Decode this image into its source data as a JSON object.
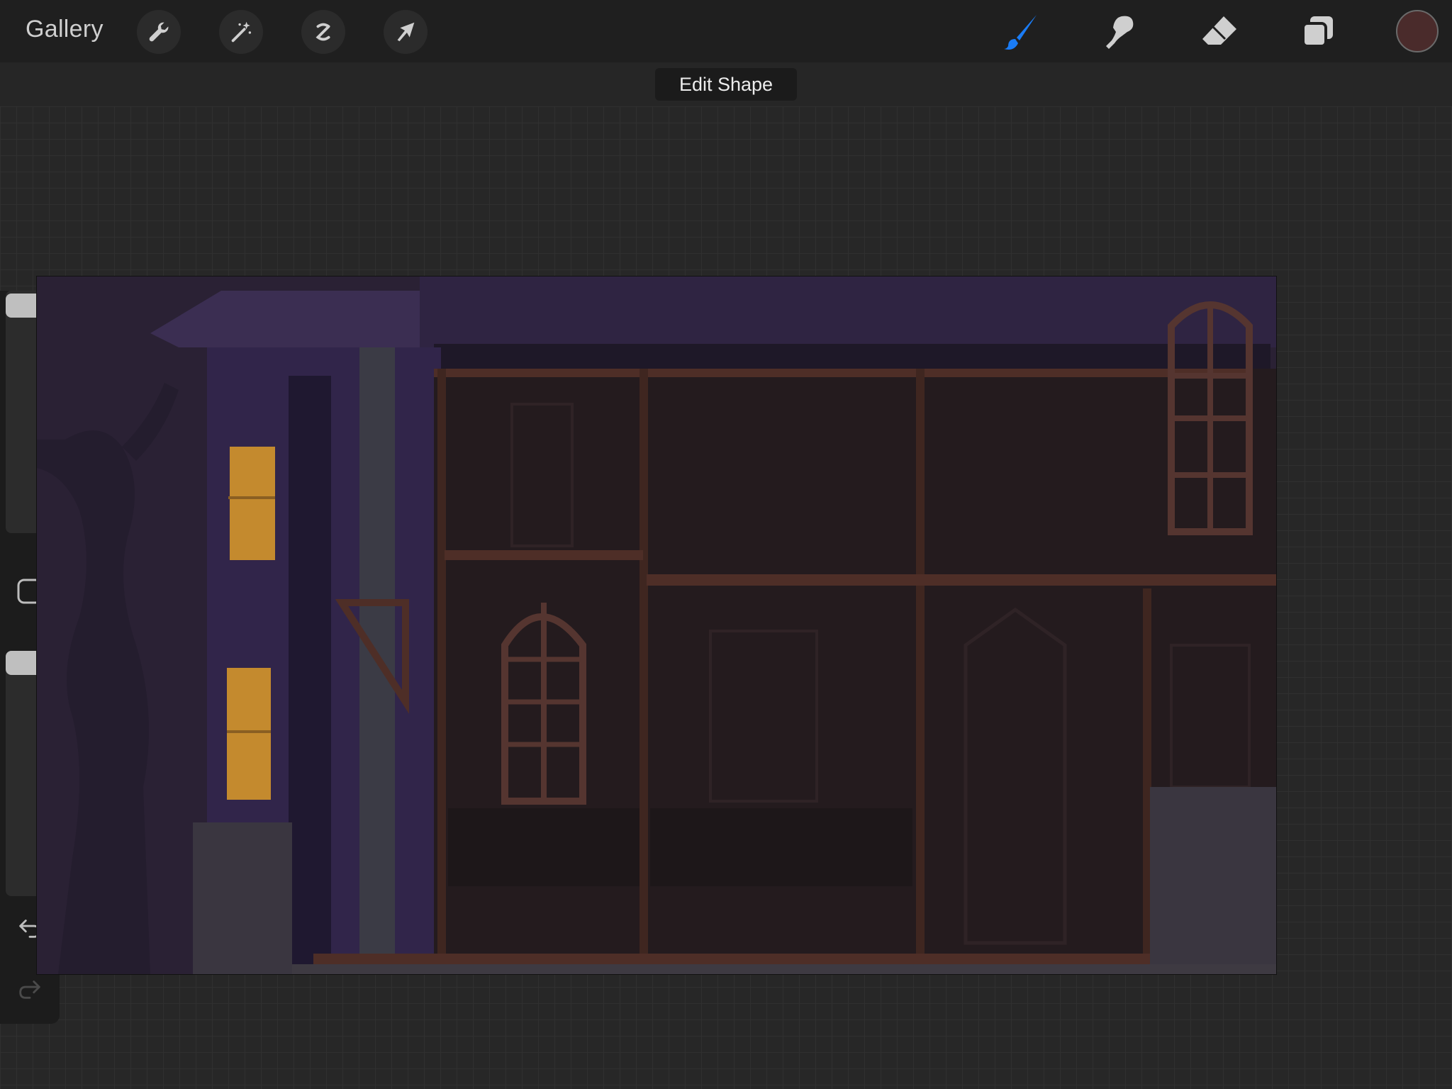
{
  "toolbar": {
    "gallery_label": "Gallery",
    "left_tools": [
      "wrench-icon",
      "magic-wand-icon",
      "selection-icon",
      "transform-arrow-icon"
    ],
    "right_tools": [
      "brush-icon",
      "smudge-icon",
      "eraser-icon",
      "layers-icon"
    ],
    "active_tool": "brush-icon",
    "active_color": "#4a2b2b",
    "accent": "#1a7cf5"
  },
  "hint": {
    "label": "Edit Shape"
  },
  "sidebar": {
    "items": [
      "brush-size-slider",
      "modify-button",
      "opacity-slider",
      "undo-icon",
      "redo-icon"
    ]
  },
  "canvas": {
    "description_colors": {
      "sky": "#2a2134",
      "wall": "#241b1e",
      "beam": "#4e2e27",
      "window_light": "#c48a2e",
      "stone": "#3e3a42"
    }
  }
}
